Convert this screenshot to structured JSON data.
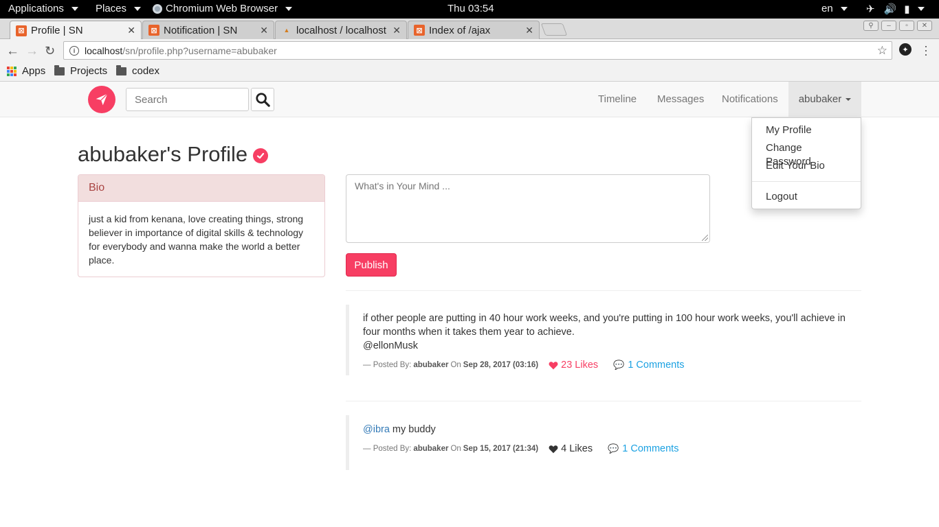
{
  "system_bar": {
    "applications": "Applications",
    "places": "Places",
    "browser": "Chromium Web Browser",
    "clock": "Thu 03:54",
    "language": "en"
  },
  "tabs": [
    {
      "title": "Profile | SN",
      "active": true
    },
    {
      "title": "Notification | SN",
      "active": false
    },
    {
      "title": "localhost / localhost",
      "active": false
    },
    {
      "title": "Index of /ajax",
      "active": false
    }
  ],
  "address": {
    "host": "localhost",
    "path": "/sn/profile.php?username=abubaker"
  },
  "bookmarks": {
    "apps": "Apps",
    "folder1": "Projects",
    "folder2": "codex"
  },
  "navbar": {
    "search_placeholder": "Search",
    "links": {
      "timeline": "Timeline",
      "messages": "Messages",
      "notifications": "Notifications"
    },
    "user": "abubaker"
  },
  "dropdown": {
    "my_profile": "My Profile",
    "change_password": "Change Password",
    "edit_bio": "Edit Your Bio",
    "logout": "Logout"
  },
  "profile": {
    "title": "abubaker's Profile",
    "bio_heading": "Bio",
    "bio_text": "just a kid from kenana, love creating things, strong believer in importance of digital skills & technology for everybody and wanna make the world a better place."
  },
  "composer": {
    "placeholder": "What's in Your Mind ...",
    "publish": "Publish"
  },
  "posts": [
    {
      "text": "if other people are putting in 40 hour work weeks, and you're putting in 100 hour work weeks, you'll achieve in four months when it takes them year to achieve.",
      "tag": "@ellonMusk",
      "posted_by_label": "— Posted By:",
      "author": "abubaker",
      "on_label": "On",
      "date": "Sep 28, 2017 (03:16)",
      "likes": "23 Likes",
      "comments": "1 Comments"
    },
    {
      "mention": "@ibra",
      "text": " my buddy",
      "posted_by_label": "— Posted By:",
      "author": "abubaker",
      "on_label": "On",
      "date": "Sep 15, 2017 (21:34)",
      "likes": "4 Likes",
      "comments": "1 Comments"
    }
  ],
  "colors": {
    "brand": "#f73e63",
    "link": "#337ab7",
    "comments": "#1ba1e2",
    "bio_bg": "#f2dede",
    "bio_text": "#a94442"
  }
}
